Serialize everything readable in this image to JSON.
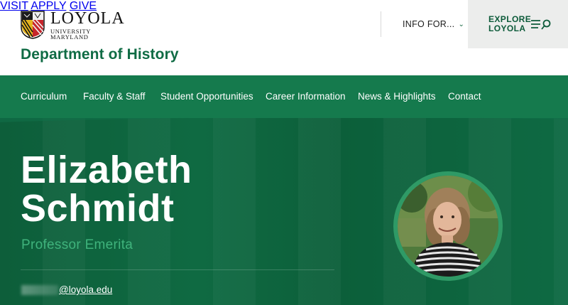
{
  "brand": {
    "name": "LOYOLA",
    "sub": "UNIVERSITY MARYLAND"
  },
  "topnav": {
    "visit": "VISIT",
    "apply": "APPLY",
    "give": "GIVE",
    "info": "INFO FOR..."
  },
  "explore": {
    "line1": "EXPLORE",
    "line2": "LOYOLA"
  },
  "department": "Department of History",
  "subnav": [
    "Curriculum",
    "Faculty & Staff",
    "Student Opportunities",
    "Career Information",
    "News & Highlights",
    "Contact"
  ],
  "profile": {
    "first_name": "Elizabeth",
    "last_name": "Schmidt",
    "title": "Professor Emerita",
    "email_domain": "@loyola.edu"
  },
  "colors": {
    "brand_green": "#157a4d",
    "hero_green": "#0f6a42",
    "accent_green": "#3fb37c"
  }
}
